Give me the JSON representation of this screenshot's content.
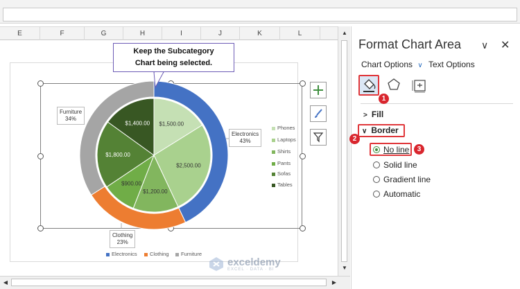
{
  "formula_bar": {
    "value": ""
  },
  "columns": [
    "E",
    "F",
    "G",
    "H",
    "I",
    "J",
    "K",
    "L"
  ],
  "chart": {
    "callout": [
      "Keep the Subcategory",
      "Chart being selected."
    ],
    "outer_labels": {
      "furniture": [
        "Furniture",
        "34%"
      ],
      "electronics": [
        "Electronics",
        "43%"
      ],
      "clothing": [
        "Clothing",
        "23%"
      ]
    },
    "inner_labels": [
      "$1,400.00",
      "$1,500.00",
      "$1,800.00",
      "$2,500.00",
      "$900.00",
      "$1,200.00"
    ],
    "legend_right": [
      "Phones",
      "Laptops",
      "Shirts",
      "Pants",
      "Sofas",
      "Tables"
    ],
    "legend_bottom": [
      "Electronics",
      "Clothing",
      "Furniture"
    ],
    "colors": {
      "electronics": "#4472c4",
      "clothing": "#ed7d31",
      "furniture": "#a5a5a5",
      "inner": [
        "#385723",
        "#c5e0b4",
        "#548235",
        "#a9d18e",
        "#70ad47",
        "#82b65e"
      ]
    }
  },
  "chart_data": {
    "type": "pie",
    "series": [
      {
        "values": [
          43,
          23,
          34
        ],
        "categories": [
          "Electronics",
          "Clothing",
          "Furniture"
        ]
      },
      {
        "categories": [
          "Phones",
          "Laptops",
          "Shirts",
          "Pants",
          "Sofas",
          "Tables"
        ],
        "values": [
          1500,
          2500,
          1200,
          900,
          1800,
          1400
        ]
      }
    ]
  },
  "panel": {
    "title": "Format Chart Area",
    "tab_chart_options": "Chart Options",
    "tab_text_options": "Text Options",
    "fill_label": "Fill",
    "border_label": "Border",
    "options": [
      "No line",
      "Solid line",
      "Gradient line",
      "Automatic"
    ],
    "badges": [
      "1",
      "2",
      "3"
    ]
  },
  "watermark": {
    "brand": "exceldemy",
    "tag": "EXCEL · DATA · BI"
  }
}
